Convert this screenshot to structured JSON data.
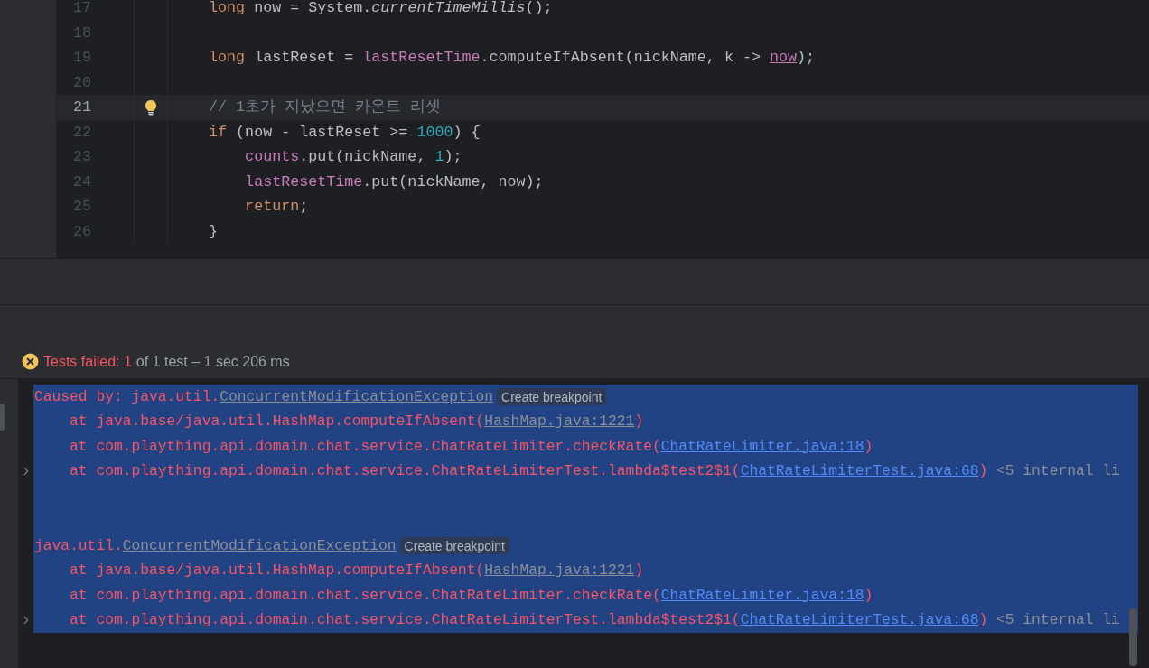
{
  "editor": {
    "lines": [
      {
        "number": "17",
        "current": false,
        "bulb": false,
        "tokens": [
          {
            "kind": "keyword",
            "text": "    long"
          },
          {
            "kind": "plain",
            "text": " now = System."
          },
          {
            "kind": "static",
            "text": "currentTimeMillis"
          },
          {
            "kind": "plain",
            "text": "();"
          }
        ]
      },
      {
        "number": "18",
        "current": false,
        "bulb": false
      },
      {
        "number": "19",
        "current": false,
        "bulb": false,
        "tokens": [
          {
            "kind": "keyword",
            "text": "    long"
          },
          {
            "kind": "plain",
            "text": " lastReset = "
          },
          {
            "kind": "field",
            "text": "lastResetTime"
          },
          {
            "kind": "plain",
            "text": ".computeIfAbsent(nickName, k -> "
          },
          {
            "kind": "captured",
            "text": "now"
          },
          {
            "kind": "plain",
            "text": ");"
          }
        ]
      },
      {
        "number": "20",
        "current": false,
        "bulb": false
      },
      {
        "number": "21",
        "current": true,
        "bulb": true,
        "tokens": [
          {
            "kind": "comment",
            "text": "    // 1초가 지났으면 카운트 리셋"
          }
        ]
      },
      {
        "number": "22",
        "current": false,
        "bulb": false,
        "tokens": [
          {
            "kind": "keyword",
            "text": "    if"
          },
          {
            "kind": "plain",
            "text": " (now - lastReset >= "
          },
          {
            "kind": "number",
            "text": "1000"
          },
          {
            "kind": "plain",
            "text": ") {"
          }
        ]
      },
      {
        "number": "23",
        "current": false,
        "bulb": false,
        "tokens": [
          {
            "kind": "field",
            "text": "        counts"
          },
          {
            "kind": "plain",
            "text": ".put(nickName, "
          },
          {
            "kind": "number",
            "text": "1"
          },
          {
            "kind": "plain",
            "text": ");"
          }
        ]
      },
      {
        "number": "24",
        "current": false,
        "bulb": false,
        "tokens": [
          {
            "kind": "field",
            "text": "        lastResetTime"
          },
          {
            "kind": "plain",
            "text": ".put(nickName, now);"
          }
        ]
      },
      {
        "number": "25",
        "current": false,
        "bulb": false,
        "tokens": [
          {
            "kind": "keyword",
            "text": "        return"
          },
          {
            "kind": "plain",
            "text": ";"
          }
        ]
      },
      {
        "number": "26",
        "current": false,
        "bulb": false,
        "tokens": [
          {
            "kind": "plain",
            "text": "    }"
          }
        ]
      }
    ]
  },
  "test_status": {
    "failed": true,
    "parts": [
      {
        "kind": "error",
        "text": "Tests failed: 1"
      },
      {
        "kind": "muted",
        "text": "of 1 test – 1 sec 206 ms"
      }
    ]
  },
  "console": {
    "lines": [
      {
        "kind": "text",
        "selected": true,
        "expander": false,
        "tokens": [
          {
            "kind": "error",
            "text": "Caused by: java.util."
          },
          {
            "kind": "class_link",
            "text": "ConcurrentModificationException"
          }
        ],
        "action": "Create breakpoint"
      },
      {
        "kind": "text",
        "selected": true,
        "expander": false,
        "tokens": [
          {
            "kind": "error",
            "text": "    at java.base/java.util.HashMap.computeIfAbsent("
          },
          {
            "kind": "lib_link",
            "text": "HashMap.java:1221"
          },
          {
            "kind": "error",
            "text": ")"
          }
        ]
      },
      {
        "kind": "text",
        "selected": true,
        "expander": false,
        "tokens": [
          {
            "kind": "error",
            "text": "    at com.plaything.api.domain.chat.service.ChatRateLimiter.checkRate("
          },
          {
            "kind": "link",
            "text": "ChatRateLimiter.java:18"
          },
          {
            "kind": "error",
            "text": ")"
          }
        ]
      },
      {
        "kind": "text",
        "selected": true,
        "expander": true,
        "tokens": [
          {
            "kind": "error",
            "text": "    at com.plaything.api.domain.chat.service.ChatRateLimiterTest.lambda$test2$1("
          },
          {
            "kind": "link",
            "text": "ChatRateLimiterTest.java:68"
          },
          {
            "kind": "error",
            "text": ")"
          },
          {
            "kind": "muted",
            "text": " <5 internal li"
          }
        ]
      },
      {
        "kind": "blank",
        "selected": true,
        "expander": false
      },
      {
        "kind": "blank",
        "selected": true,
        "expander": false
      },
      {
        "kind": "text",
        "selected": true,
        "expander": false,
        "tokens": [
          {
            "kind": "error",
            "text": "java.util."
          },
          {
            "kind": "class_link",
            "text": "ConcurrentModificationException"
          }
        ],
        "action": "Create breakpoint"
      },
      {
        "kind": "text",
        "selected": true,
        "expander": false,
        "tokens": [
          {
            "kind": "error",
            "text": "    at java.base/java.util.HashMap.computeIfAbsent("
          },
          {
            "kind": "lib_link",
            "text": "HashMap.java:1221"
          },
          {
            "kind": "error",
            "text": ")"
          }
        ]
      },
      {
        "kind": "text",
        "selected": true,
        "expander": false,
        "tokens": [
          {
            "kind": "error",
            "text": "    at com.plaything.api.domain.chat.service.ChatRateLimiter.checkRate("
          },
          {
            "kind": "link",
            "text": "ChatRateLimiter.java:18"
          },
          {
            "kind": "error",
            "text": ")"
          }
        ]
      },
      {
        "kind": "text",
        "selected": true,
        "expander": true,
        "tokens": [
          {
            "kind": "error",
            "text": "    at com.plaything.api.domain.chat.service.ChatRateLimiterTest.lambda$test2$1("
          },
          {
            "kind": "link",
            "text": "ChatRateLimiterTest.java:68"
          },
          {
            "kind": "error",
            "text": ")"
          },
          {
            "kind": "muted",
            "text": " <5 internal li"
          }
        ]
      }
    ]
  }
}
